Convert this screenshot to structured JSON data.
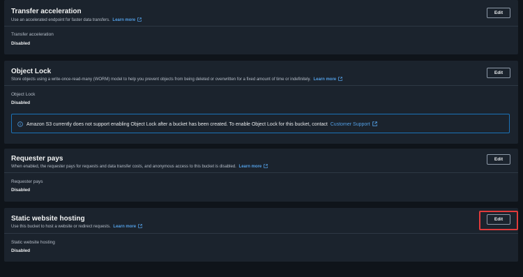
{
  "transfer_acceleration": {
    "title": "Transfer acceleration",
    "description": "Use an accelerated endpoint for faster data transfers.",
    "learn_more": "Learn more",
    "edit_label": "Edit",
    "prop_label": "Transfer acceleration",
    "prop_value": "Disabled"
  },
  "object_lock": {
    "title": "Object Lock",
    "description": "Store objects using a write-once-read-many (WORM) model to help you prevent objects from being deleted or overwritten for a fixed amount of time or indefinitely.",
    "learn_more": "Learn more",
    "edit_label": "Edit",
    "prop_label": "Object Lock",
    "prop_value": "Disabled",
    "info_text": "Amazon S3 currently does not support enabling Object Lock after a bucket has been created. To enable Object Lock for this bucket, contact",
    "info_link": "Customer Support"
  },
  "requester_pays": {
    "title": "Requester pays",
    "description": "When enabled, the requester pays for requests and data transfer costs, and anonymous access to this bucket is disabled.",
    "learn_more": "Learn more",
    "edit_label": "Edit",
    "prop_label": "Requester pays",
    "prop_value": "Disabled"
  },
  "static_website_hosting": {
    "title": "Static website hosting",
    "description": "Use this bucket to host a website or redirect requests.",
    "learn_more": "Learn more",
    "edit_label": "Edit",
    "prop_label": "Static website hosting",
    "prop_value": "Disabled"
  },
  "colors": {
    "link": "#539fe5",
    "info_border": "#1b73b9",
    "highlight": "#e23b3b"
  }
}
